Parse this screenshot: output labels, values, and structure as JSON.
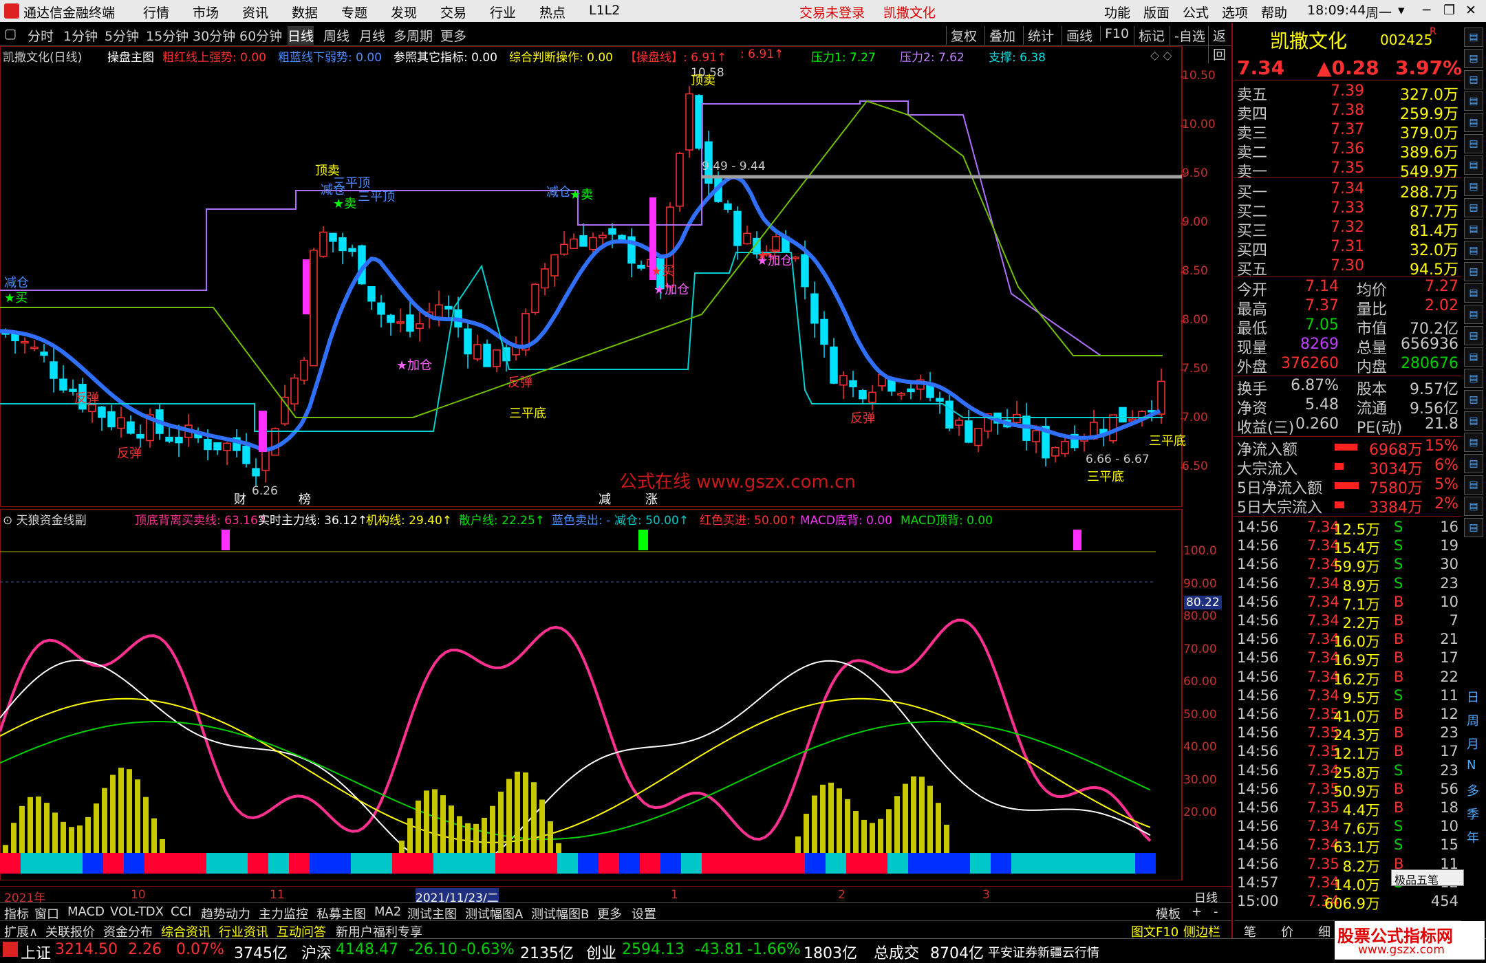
{
  "menubar": {
    "app_title": "通达信金融终端",
    "items": [
      "行情",
      "市场",
      "资讯",
      "数据",
      "专题",
      "发现",
      "交易",
      "行业",
      "热点",
      "L1L2"
    ],
    "login": "交易未登录",
    "stock": "凯撒文化",
    "right_items": [
      "功能",
      "版面",
      "公式",
      "选项",
      "帮助"
    ],
    "time": "18:09:44",
    "weekday": "周一"
  },
  "toolbar": {
    "periods": [
      "分时",
      "1分钟",
      "5分钟",
      "15分钟",
      "30分钟",
      "60分钟",
      "日线",
      "周线",
      "月线",
      "多周期",
      "更多"
    ],
    "active": "日线",
    "right": [
      "复权",
      "叠加",
      "统计",
      "画线",
      "F10",
      "标记",
      "-自选",
      "返回"
    ]
  },
  "main_legend": {
    "title": "凯撒文化(日线)",
    "formula": "操盘主图",
    "items": [
      {
        "text": "粗红线上强势: 0.00",
        "color": "#ff3030"
      },
      {
        "text": "粗蓝线下弱势: 0.00",
        "color": "#4a8cff"
      },
      {
        "text": "参照其它指标: 0.00",
        "color": "#ffffff"
      },
      {
        "text": "综合判断操作: 0.00",
        "color": "#ffff00"
      },
      {
        "text": "【操盘线】: 6.91↑",
        "color": "#ff3030"
      },
      {
        "text": ": 6.91↑",
        "color": "#ff3030"
      },
      {
        "text": "压力1: 7.27",
        "color": "#00ff00"
      },
      {
        "text": "压力2: 7.62",
        "color": "#c080ff"
      },
      {
        "text": "支撑: 6.38",
        "color": "#00e0e0"
      }
    ]
  },
  "main_axis": [
    "10.50",
    "10.00",
    "9.50",
    "9.00",
    "8.50",
    "8.00",
    "7.50",
    "7.00",
    "6.50"
  ],
  "main_annotations": {
    "high": "10.58",
    "low": "6.26",
    "range1": "9.49 - 9.44",
    "range2": "6.66 - 6.67",
    "watermark": "公式在线 www.gszx.com.cn",
    "signals": [
      {
        "t": "减仓",
        "c": "#4a8cff"
      },
      {
        "t": "★买",
        "c": "#00ff00"
      },
      {
        "t": "反弹",
        "c": "#ff3030"
      },
      {
        "t": "反弹",
        "c": "#ff3030"
      },
      {
        "t": "顶卖",
        "c": "#ffff00"
      },
      {
        "t": "三平顶",
        "c": "#4a8cff"
      },
      {
        "t": "减仓",
        "c": "#4a8cff"
      },
      {
        "t": "三平顶",
        "c": "#4a8cff"
      },
      {
        "t": "★卖",
        "c": "#00ff00"
      },
      {
        "t": "★加仓",
        "c": "#ff60ff"
      },
      {
        "t": "反弹",
        "c": "#ff3030"
      },
      {
        "t": "三平底",
        "c": "#ffff00"
      },
      {
        "t": "减仓",
        "c": "#4a8cff"
      },
      {
        "t": "★卖",
        "c": "#00ff00"
      },
      {
        "t": "★买",
        "c": "#ff3030"
      },
      {
        "t": "★加仓",
        "c": "#ff60ff"
      },
      {
        "t": "顶卖",
        "c": "#ffff00"
      },
      {
        "t": "★买",
        "c": "#ff3030"
      },
      {
        "t": "★加仓",
        "c": "#ff60ff"
      },
      {
        "t": "反弹",
        "c": "#ff3030"
      },
      {
        "t": "三平底",
        "c": "#ffff00"
      },
      {
        "t": "三平底",
        "c": "#ffff00"
      },
      {
        "t": "财",
        "c": "#ffffff"
      },
      {
        "t": "榜",
        "c": "#ffffff"
      },
      {
        "t": "减",
        "c": "#ffffff"
      },
      {
        "t": "涨",
        "c": "#ffffff"
      }
    ]
  },
  "sub_legend": {
    "title": "天狼资金线副",
    "items": [
      {
        "text": "顶底背离买卖线: 63.16↑",
        "color": "#ff3090"
      },
      {
        "text": "实时主力线: 36.12↑",
        "color": "#ffffff"
      },
      {
        "text": "机构线: 29.40↑",
        "color": "#ffff00"
      },
      {
        "text": "散户线: 22.25↑",
        "color": "#00e000"
      },
      {
        "text": "蓝色卖出: -",
        "color": "#4a8cff"
      },
      {
        "text": "减仓: 50.00↑",
        "color": "#00c8c8"
      },
      {
        "text": "红色买进: 50.00↑",
        "color": "#ff3030"
      },
      {
        "text": "MACD底背: 0.00",
        "color": "#ff30ff"
      },
      {
        "text": "MACD顶背: 0.00",
        "color": "#00e000"
      }
    ]
  },
  "sub_axis": [
    "100.0",
    "90.00",
    "80.00",
    "70.00",
    "60.00",
    "50.00",
    "40.00",
    "30.00",
    "20.00"
  ],
  "sub_marker": "80.22",
  "date_axis": {
    "labels": [
      "2021年",
      "10",
      "11",
      "2021/11/23/二",
      "1",
      "2",
      "3"
    ],
    "right": "日线"
  },
  "bottom_tabs": [
    "指标",
    "窗口",
    "MACD",
    "VOL-TDX",
    "CCI",
    "趋势动力",
    "主力监控",
    "私募主图",
    "MA2",
    "测试主图",
    "测试幅图A",
    "测试幅图B",
    "更多",
    "设置"
  ],
  "bottom_right": [
    "模板",
    "+",
    "-"
  ],
  "bottom_tabs2": [
    "扩展∧",
    "关联报价",
    "资金分布",
    "综合资讯",
    "行业资讯",
    "互动问答",
    "新用户福利专享"
  ],
  "bottom_tabs2_right": [
    "图文F10",
    "侧边栏《",
    "笔",
    "价",
    "细",
    "势"
  ],
  "quote": {
    "name": "凯撒文化",
    "code": "002425",
    "tag": "R",
    "price": "7.34",
    "change": "▲0.28",
    "pct": "3.97%",
    "asks": [
      {
        "l": "卖五",
        "p": "7.39",
        "v": "327.0万",
        "mark": "¥"
      },
      {
        "l": "卖四",
        "p": "7.38",
        "v": "259.9万"
      },
      {
        "l": "卖三",
        "p": "7.37",
        "v": "379.0万"
      },
      {
        "l": "卖二",
        "p": "7.36",
        "v": "389.6万"
      },
      {
        "l": "卖一",
        "p": "7.35",
        "v": "549.9万"
      }
    ],
    "bids": [
      {
        "l": "买一",
        "p": "7.34",
        "v": "288.7万"
      },
      {
        "l": "买二",
        "p": "7.33",
        "v": "87.7万"
      },
      {
        "l": "买三",
        "p": "7.32",
        "v": "81.4万"
      },
      {
        "l": "买四",
        "p": "7.31",
        "v": "32.0万"
      },
      {
        "l": "买五",
        "p": "7.30",
        "v": "94.5万"
      }
    ],
    "stats": [
      {
        "a": "今开",
        "av": "7.14",
        "ac": "#ff3030",
        "b": "均价",
        "bv": "7.27",
        "bc": "#ff3030"
      },
      {
        "a": "最高",
        "av": "7.37",
        "ac": "#ff3030",
        "b": "量比",
        "bv": "2.02",
        "bc": "#ff3030"
      },
      {
        "a": "最低",
        "av": "7.05",
        "ac": "#00d000",
        "b": "市值",
        "bv": "70.2亿",
        "bc": "#c8c8c8"
      },
      {
        "a": "现量",
        "av": "8269",
        "ac": "#c040ff",
        "b": "总量",
        "bv": "656936",
        "bc": "#c8c8c8"
      },
      {
        "a": "外盘",
        "av": "376260",
        "ac": "#ff3030",
        "b": "内盘",
        "bv": "280676",
        "bc": "#00d000"
      }
    ],
    "stats2": [
      {
        "a": "换手",
        "av": "6.87%",
        "b": "股本",
        "bv": "9.57亿"
      },
      {
        "a": "净资",
        "av": "5.48",
        "b": "流通",
        "bv": "9.56亿"
      },
      {
        "a": "收益(三)",
        "av": "0.260",
        "b": "PE(动)",
        "bv": "21.8"
      }
    ],
    "flows": [
      {
        "l": "净流入额",
        "v": "6968万",
        "p": "15%",
        "bar": 0.75
      },
      {
        "l": "大宗流入",
        "v": "3034万",
        "p": "6%",
        "bar": 0.3
      },
      {
        "l": "5日净流入额",
        "v": "7580万",
        "p": "5%",
        "bar": 0.8
      },
      {
        "l": "5日大宗流入",
        "v": "3384万",
        "p": "2%",
        "bar": 0.32
      }
    ],
    "ticks": [
      {
        "t": "14:56",
        "p": "7.34",
        "v": "12.5万",
        "s": "S",
        "n": "16"
      },
      {
        "t": "14:56",
        "p": "7.34",
        "v": "15.4万",
        "s": "S",
        "n": "19"
      },
      {
        "t": "14:56",
        "p": "7.34",
        "v": "59.9万",
        "s": "S",
        "n": "30"
      },
      {
        "t": "14:56",
        "p": "7.34",
        "v": "8.9万",
        "s": "S",
        "n": "23"
      },
      {
        "t": "14:56",
        "p": "7.34",
        "v": "7.1万",
        "s": "B",
        "n": "10"
      },
      {
        "t": "14:56",
        "p": "7.34",
        "v": "2.2万",
        "s": "B",
        "n": "7"
      },
      {
        "t": "14:56",
        "p": "7.34",
        "v": "16.0万",
        "s": "B",
        "n": "21"
      },
      {
        "t": "14:56",
        "p": "7.34",
        "v": "16.9万",
        "s": "B",
        "n": "17"
      },
      {
        "t": "14:56",
        "p": "7.34",
        "v": "16.2万",
        "s": "B",
        "n": "22"
      },
      {
        "t": "14:56",
        "p": "7.34",
        "v": "9.5万",
        "s": "S",
        "n": "11"
      },
      {
        "t": "14:56",
        "p": "7.35",
        "v": "41.0万",
        "s": "B",
        "n": "12"
      },
      {
        "t": "14:56",
        "p": "7.35",
        "v": "24.3万",
        "s": "B",
        "n": "23"
      },
      {
        "t": "14:56",
        "p": "7.35",
        "v": "12.1万",
        "s": "B",
        "n": "17"
      },
      {
        "t": "14:56",
        "p": "7.34",
        "v": "25.8万",
        "s": "S",
        "n": "23"
      },
      {
        "t": "14:56",
        "p": "7.35",
        "v": "50.9万",
        "s": "B",
        "n": "56"
      },
      {
        "t": "14:56",
        "p": "7.35",
        "v": "4.4万",
        "s": "B",
        "n": "18"
      },
      {
        "t": "14:56",
        "p": "7.34",
        "v": "7.6万",
        "s": "S",
        "n": "10"
      },
      {
        "t": "14:56",
        "p": "7.34",
        "v": "63.1万",
        "s": "S",
        "n": "15"
      },
      {
        "t": "14:56",
        "p": "7.35",
        "v": "8.2万",
        "s": "B",
        "n": "11"
      },
      {
        "t": "14:57",
        "p": "7.34",
        "v": "14.0万",
        "s": "S",
        "n": "12"
      },
      {
        "t": "15:00",
        "p": "7.34",
        "v": "606.9万",
        "s": "",
        "n": "454"
      }
    ],
    "vtools_right": [
      "日",
      "周",
      "月",
      "N",
      "多",
      "季",
      "年"
    ],
    "popup": "极品五笔"
  },
  "statusbar": {
    "items": [
      {
        "n": "上证",
        "v": "3214.50",
        "c": "2.26",
        "p": "0.07%",
        "a": "3745亿"
      },
      {
        "n": "沪深",
        "v": "4148.47",
        "c": "-26.10",
        "p": "-0.63%",
        "a": "2135亿"
      },
      {
        "n": "创业",
        "v": "2594.13",
        "c": "-43.81",
        "p": "-1.66%",
        "a": "1803亿"
      }
    ],
    "total_label": "总成交",
    "total": "8704亿",
    "broker": "平安证券新疆云行情",
    "badge": "股票公式指标网",
    "badge_url": "www.gszx.com"
  }
}
